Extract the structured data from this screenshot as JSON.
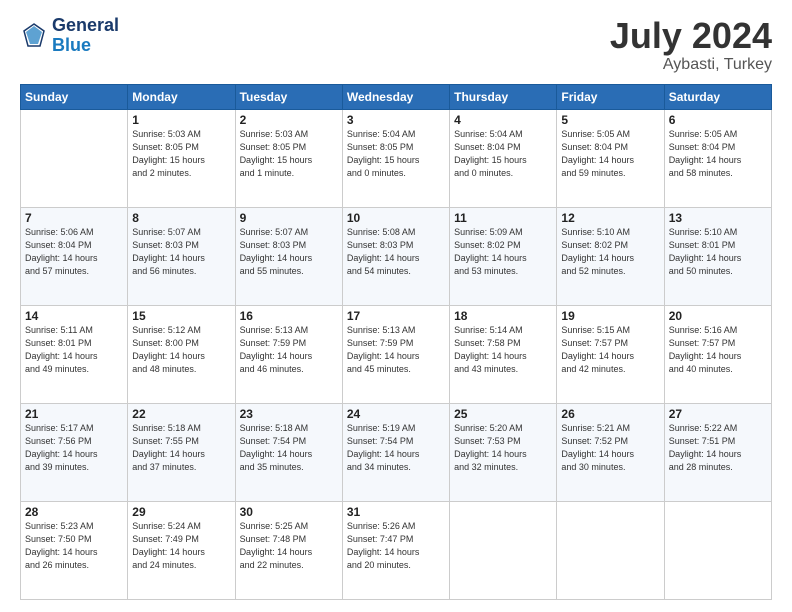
{
  "header": {
    "logo_line1": "General",
    "logo_line2": "Blue",
    "title": "July 2024",
    "subtitle": "Aybasti, Turkey"
  },
  "days_of_week": [
    "Sunday",
    "Monday",
    "Tuesday",
    "Wednesday",
    "Thursday",
    "Friday",
    "Saturday"
  ],
  "weeks": [
    [
      {
        "day": "",
        "info": ""
      },
      {
        "day": "1",
        "info": "Sunrise: 5:03 AM\nSunset: 8:05 PM\nDaylight: 15 hours\nand 2 minutes."
      },
      {
        "day": "2",
        "info": "Sunrise: 5:03 AM\nSunset: 8:05 PM\nDaylight: 15 hours\nand 1 minute."
      },
      {
        "day": "3",
        "info": "Sunrise: 5:04 AM\nSunset: 8:05 PM\nDaylight: 15 hours\nand 0 minutes."
      },
      {
        "day": "4",
        "info": "Sunrise: 5:04 AM\nSunset: 8:04 PM\nDaylight: 15 hours\nand 0 minutes."
      },
      {
        "day": "5",
        "info": "Sunrise: 5:05 AM\nSunset: 8:04 PM\nDaylight: 14 hours\nand 59 minutes."
      },
      {
        "day": "6",
        "info": "Sunrise: 5:05 AM\nSunset: 8:04 PM\nDaylight: 14 hours\nand 58 minutes."
      }
    ],
    [
      {
        "day": "7",
        "info": "Sunrise: 5:06 AM\nSunset: 8:04 PM\nDaylight: 14 hours\nand 57 minutes."
      },
      {
        "day": "8",
        "info": "Sunrise: 5:07 AM\nSunset: 8:03 PM\nDaylight: 14 hours\nand 56 minutes."
      },
      {
        "day": "9",
        "info": "Sunrise: 5:07 AM\nSunset: 8:03 PM\nDaylight: 14 hours\nand 55 minutes."
      },
      {
        "day": "10",
        "info": "Sunrise: 5:08 AM\nSunset: 8:03 PM\nDaylight: 14 hours\nand 54 minutes."
      },
      {
        "day": "11",
        "info": "Sunrise: 5:09 AM\nSunset: 8:02 PM\nDaylight: 14 hours\nand 53 minutes."
      },
      {
        "day": "12",
        "info": "Sunrise: 5:10 AM\nSunset: 8:02 PM\nDaylight: 14 hours\nand 52 minutes."
      },
      {
        "day": "13",
        "info": "Sunrise: 5:10 AM\nSunset: 8:01 PM\nDaylight: 14 hours\nand 50 minutes."
      }
    ],
    [
      {
        "day": "14",
        "info": "Sunrise: 5:11 AM\nSunset: 8:01 PM\nDaylight: 14 hours\nand 49 minutes."
      },
      {
        "day": "15",
        "info": "Sunrise: 5:12 AM\nSunset: 8:00 PM\nDaylight: 14 hours\nand 48 minutes."
      },
      {
        "day": "16",
        "info": "Sunrise: 5:13 AM\nSunset: 7:59 PM\nDaylight: 14 hours\nand 46 minutes."
      },
      {
        "day": "17",
        "info": "Sunrise: 5:13 AM\nSunset: 7:59 PM\nDaylight: 14 hours\nand 45 minutes."
      },
      {
        "day": "18",
        "info": "Sunrise: 5:14 AM\nSunset: 7:58 PM\nDaylight: 14 hours\nand 43 minutes."
      },
      {
        "day": "19",
        "info": "Sunrise: 5:15 AM\nSunset: 7:57 PM\nDaylight: 14 hours\nand 42 minutes."
      },
      {
        "day": "20",
        "info": "Sunrise: 5:16 AM\nSunset: 7:57 PM\nDaylight: 14 hours\nand 40 minutes."
      }
    ],
    [
      {
        "day": "21",
        "info": "Sunrise: 5:17 AM\nSunset: 7:56 PM\nDaylight: 14 hours\nand 39 minutes."
      },
      {
        "day": "22",
        "info": "Sunrise: 5:18 AM\nSunset: 7:55 PM\nDaylight: 14 hours\nand 37 minutes."
      },
      {
        "day": "23",
        "info": "Sunrise: 5:18 AM\nSunset: 7:54 PM\nDaylight: 14 hours\nand 35 minutes."
      },
      {
        "day": "24",
        "info": "Sunrise: 5:19 AM\nSunset: 7:54 PM\nDaylight: 14 hours\nand 34 minutes."
      },
      {
        "day": "25",
        "info": "Sunrise: 5:20 AM\nSunset: 7:53 PM\nDaylight: 14 hours\nand 32 minutes."
      },
      {
        "day": "26",
        "info": "Sunrise: 5:21 AM\nSunset: 7:52 PM\nDaylight: 14 hours\nand 30 minutes."
      },
      {
        "day": "27",
        "info": "Sunrise: 5:22 AM\nSunset: 7:51 PM\nDaylight: 14 hours\nand 28 minutes."
      }
    ],
    [
      {
        "day": "28",
        "info": "Sunrise: 5:23 AM\nSunset: 7:50 PM\nDaylight: 14 hours\nand 26 minutes."
      },
      {
        "day": "29",
        "info": "Sunrise: 5:24 AM\nSunset: 7:49 PM\nDaylight: 14 hours\nand 24 minutes."
      },
      {
        "day": "30",
        "info": "Sunrise: 5:25 AM\nSunset: 7:48 PM\nDaylight: 14 hours\nand 22 minutes."
      },
      {
        "day": "31",
        "info": "Sunrise: 5:26 AM\nSunset: 7:47 PM\nDaylight: 14 hours\nand 20 minutes."
      },
      {
        "day": "",
        "info": ""
      },
      {
        "day": "",
        "info": ""
      },
      {
        "day": "",
        "info": ""
      }
    ]
  ]
}
